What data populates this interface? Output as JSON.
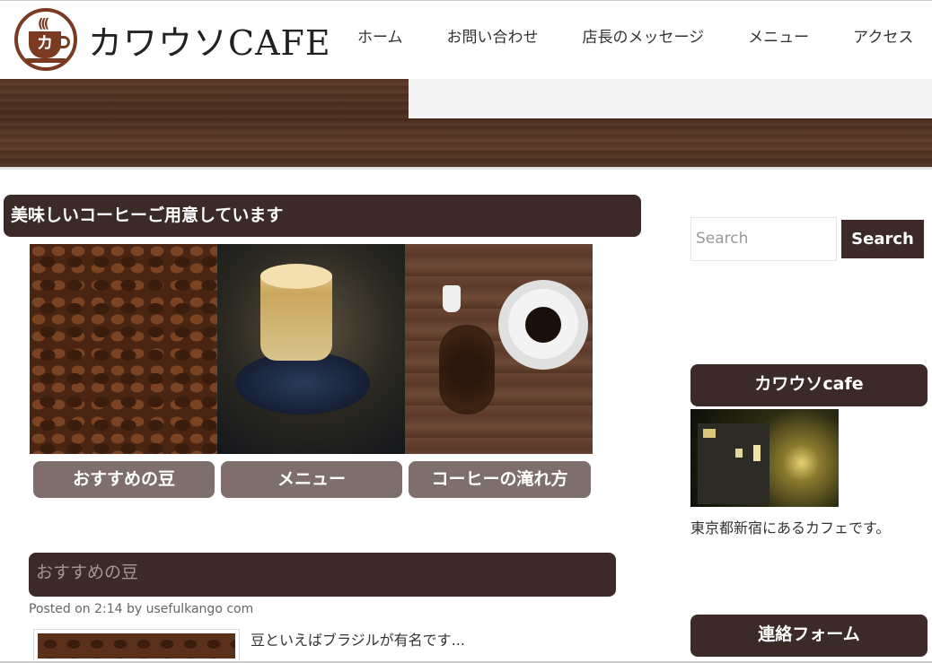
{
  "header": {
    "logo_text": "カワウソCAFE",
    "logo_cup_letter": "カ",
    "nav": [
      "ホーム",
      "お問い合わせ",
      "店長のメッセージ",
      "メニュー",
      "アクセス"
    ]
  },
  "main": {
    "section_title": "美味しいコーヒーご用意しています",
    "tiles": [
      {
        "label": "おすすめの豆",
        "image": "coffee-beans-photo"
      },
      {
        "label": "メニュー",
        "image": "latte-photo"
      },
      {
        "label": "コーヒーの滝れ方",
        "image": "coffee-cup-table-photo"
      }
    ],
    "post": {
      "title": "おすすめの豆",
      "meta": "Posted on 2:14 by usefulkango com",
      "excerpt": "豆といえばブラジルが有名です..."
    }
  },
  "sidebar": {
    "search_placeholder": "Search",
    "search_button": "Search",
    "widget1_title": "カワウソcafe",
    "widget1_text": "東京都新宿にあるカフェです。",
    "widget2_title": "連絡フォーム"
  },
  "colors": {
    "dark_brown": "#3b2a28",
    "tile_button": "#7f6f6c",
    "logo_brown": "#7a3b22"
  }
}
